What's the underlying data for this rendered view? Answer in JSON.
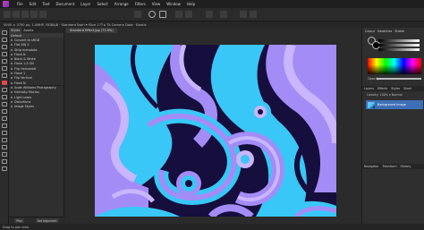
{
  "menu": {
    "items": [
      "File",
      "Edit",
      "Text",
      "Document",
      "Layer",
      "Select",
      "Arrange",
      "Filters",
      "View",
      "Window",
      "Help"
    ]
  },
  "context": {
    "text": "5000 × 3750 px, 1.0MHP, RGBA/8 · Standard Swirl ▾ Slice 177 ▸ Tk Camera Data · Elastic"
  },
  "left_panel": {
    "tabs": [
      "Styles",
      "Assets"
    ],
    "header": "Default",
    "items": [
      "Convert to sRGB",
      "Flat ADJ 2",
      "Strip metadata",
      "Flash N",
      "Black & White",
      "Flash 1-3 ON",
      "Flip Horizontal",
      "Flash 1",
      "Flip Vertical",
      "Flash N",
      "Scott Williams Photography",
      "Intensity Macros",
      "Light Leaks",
      "Distortions",
      "Image Styles"
    ],
    "bottom_buttons": [
      "Play",
      "Set argument"
    ]
  },
  "document": {
    "tab_title": "Standard Effect.jpg (73.9%)"
  },
  "right_panel": {
    "top_tabs": [
      "Colour",
      "Swatches",
      "Stroke"
    ],
    "opacity_label": "Opacity",
    "opacity_value": 1.0,
    "layer_tabs": [
      "Layers",
      "Effects",
      "Styles",
      "Stock"
    ],
    "blend_text": "Opacity: 100% ▾ Normal",
    "layer_name": "Background Image",
    "lower_tabs": [
      "Navigator",
      "Transform",
      "History"
    ]
  },
  "status": {
    "text": "Drag to pan view."
  },
  "colors": {
    "canvas_bg": "#160e3d",
    "swirl_cyan": "#38c7f6",
    "swirl_violet": "#a48cf6",
    "swirl_lavender": "#c9b6ff",
    "accent": "#3e6fb6"
  }
}
